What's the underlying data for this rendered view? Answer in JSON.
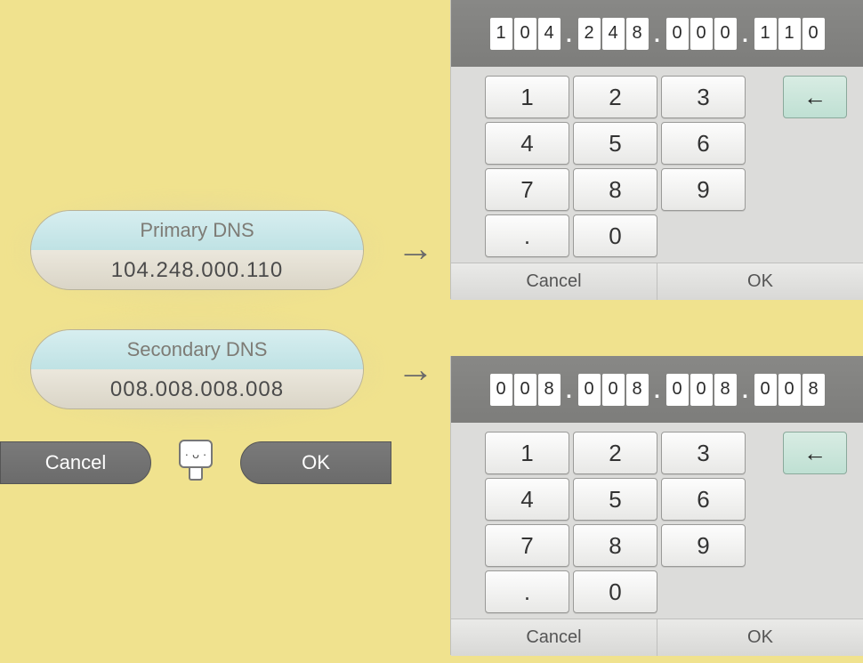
{
  "left": {
    "primary_label": "Primary DNS",
    "primary_value": "104.248.000.110",
    "secondary_label": "Secondary DNS",
    "secondary_value": "008.008.008.008",
    "cancel": "Cancel",
    "ok": "OK",
    "avatar_face": "· ᴗ ·"
  },
  "arrows": {
    "glyph": "→"
  },
  "keypad": {
    "keys": [
      "1",
      "2",
      "3",
      "4",
      "5",
      "6",
      "7",
      "8",
      "9",
      ".",
      "0"
    ],
    "back_glyph": "←",
    "cancel": "Cancel",
    "ok": "OK"
  },
  "keypad1": {
    "digits": [
      "1",
      "0",
      "4",
      "2",
      "4",
      "8",
      "0",
      "0",
      "0",
      "1",
      "1",
      "0"
    ]
  },
  "keypad2": {
    "digits": [
      "0",
      "0",
      "8",
      "0",
      "0",
      "8",
      "0",
      "0",
      "8",
      "0",
      "0",
      "8"
    ]
  }
}
